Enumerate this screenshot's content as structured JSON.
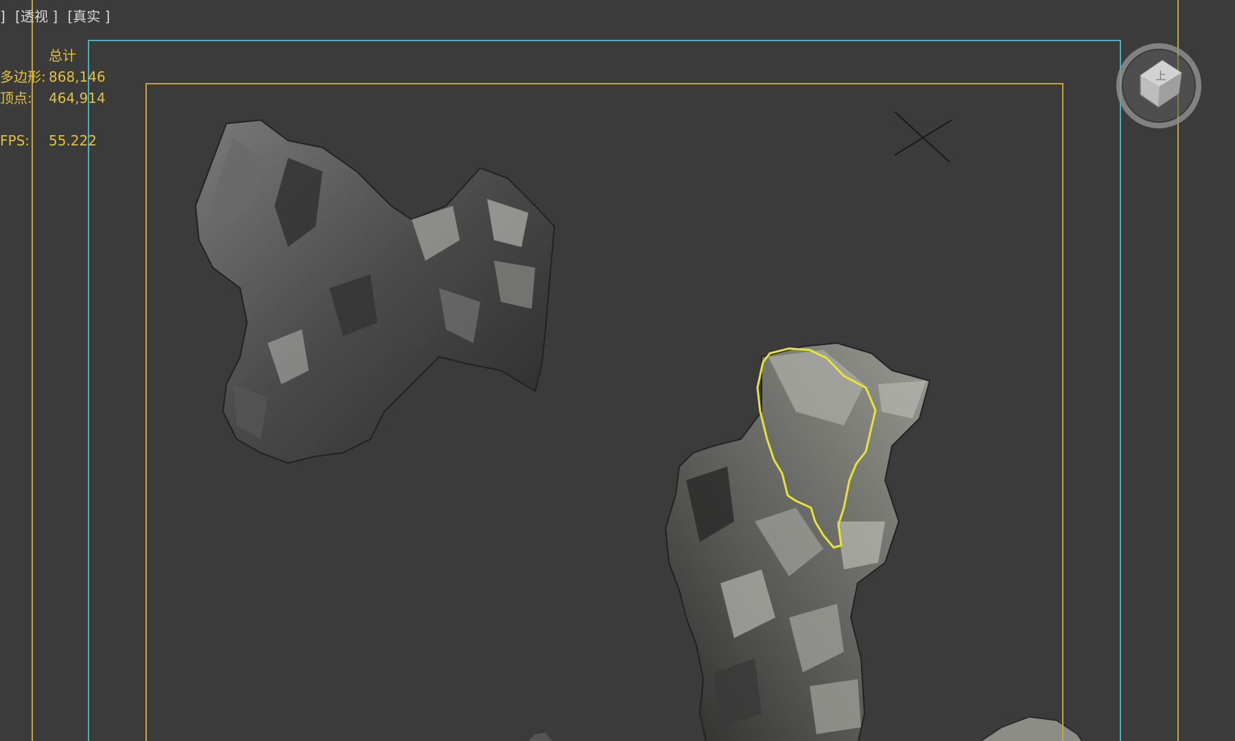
{
  "viewport": {
    "labels": [
      "]",
      "[透视 ]",
      "[真实 ]"
    ]
  },
  "stats": {
    "header": "总计",
    "polygons_label": "多边形:",
    "polygons_value": "868,146",
    "vertices_label": "顶点:",
    "vertices_value": "464,914",
    "fps_label": "FPS:",
    "fps_value": "55.222"
  },
  "viewcube": {
    "face_label": "上"
  },
  "colors": {
    "background": "#3b3b3b",
    "stats_text": "#e4c23a",
    "safe_frame_cyan": "#3fb5c4",
    "safe_frame_gold": "#c9a43a",
    "selection_outline": "#e8e23a"
  }
}
